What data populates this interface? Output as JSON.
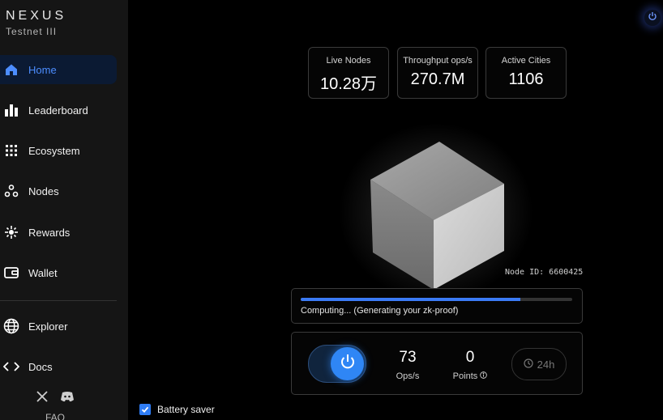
{
  "brand": {
    "name": "NEXUS",
    "subtitle": "Testnet III"
  },
  "nav": {
    "items": [
      {
        "label": "Home",
        "icon": "home-icon",
        "active": true
      },
      {
        "label": "Leaderboard",
        "icon": "bar-chart-icon"
      },
      {
        "label": "Ecosystem",
        "icon": "grid-icon"
      },
      {
        "label": "Nodes",
        "icon": "nodes-icon"
      },
      {
        "label": "Rewards",
        "icon": "sparkle-icon"
      },
      {
        "label": "Wallet",
        "icon": "wallet-icon"
      },
      {
        "label": "Explorer",
        "icon": "globe-icon"
      },
      {
        "label": "Docs",
        "icon": "code-icon"
      }
    ],
    "faq": "FAQ"
  },
  "stats": [
    {
      "title": "Live Nodes",
      "value": "10.28万"
    },
    {
      "title": "Throughput ops/s",
      "value": "270.7M"
    },
    {
      "title": "Active Cities",
      "value": "1106"
    }
  ],
  "node": {
    "id_text": "Node ID: 6600425"
  },
  "progress": {
    "fraction": 0.81,
    "status": "Computing... (Generating your zk-proof)"
  },
  "controls": {
    "ops_value": "73",
    "ops_label": "Ops/s",
    "points_value": "0",
    "points_label": "Points",
    "timer_label": "24h"
  },
  "battery": {
    "label": "Battery saver",
    "checked": true
  },
  "colors": {
    "accent": "#3b7bf5",
    "background": "#000000",
    "sidebar": "#151515"
  }
}
